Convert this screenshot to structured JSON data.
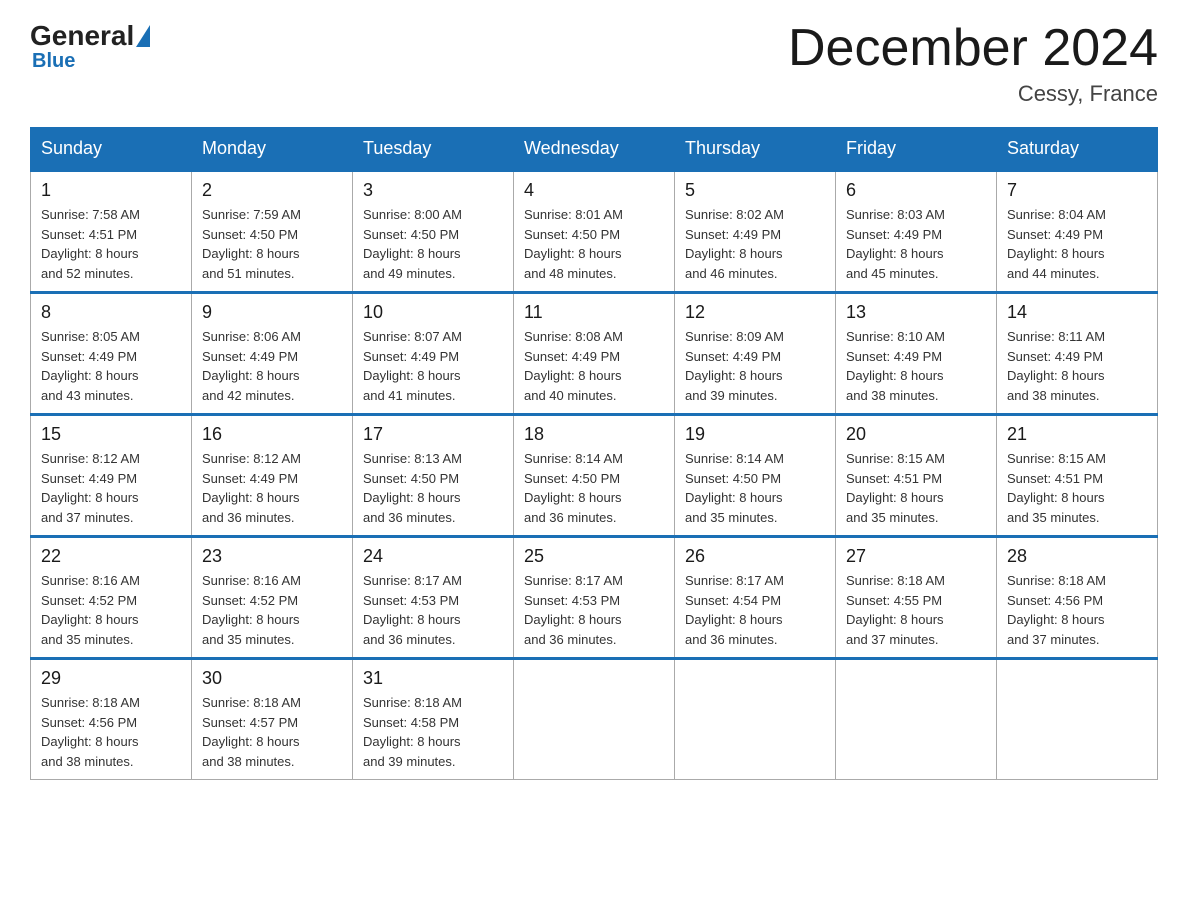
{
  "header": {
    "logo_general": "General",
    "logo_blue": "Blue",
    "month_title": "December 2024",
    "location": "Cessy, France"
  },
  "days_of_week": [
    "Sunday",
    "Monday",
    "Tuesday",
    "Wednesday",
    "Thursday",
    "Friday",
    "Saturday"
  ],
  "weeks": [
    [
      {
        "day": "1",
        "sunrise": "7:58 AM",
        "sunset": "4:51 PM",
        "daylight": "8 hours and 52 minutes."
      },
      {
        "day": "2",
        "sunrise": "7:59 AM",
        "sunset": "4:50 PM",
        "daylight": "8 hours and 51 minutes."
      },
      {
        "day": "3",
        "sunrise": "8:00 AM",
        "sunset": "4:50 PM",
        "daylight": "8 hours and 49 minutes."
      },
      {
        "day": "4",
        "sunrise": "8:01 AM",
        "sunset": "4:50 PM",
        "daylight": "8 hours and 48 minutes."
      },
      {
        "day": "5",
        "sunrise": "8:02 AM",
        "sunset": "4:49 PM",
        "daylight": "8 hours and 46 minutes."
      },
      {
        "day": "6",
        "sunrise": "8:03 AM",
        "sunset": "4:49 PM",
        "daylight": "8 hours and 45 minutes."
      },
      {
        "day": "7",
        "sunrise": "8:04 AM",
        "sunset": "4:49 PM",
        "daylight": "8 hours and 44 minutes."
      }
    ],
    [
      {
        "day": "8",
        "sunrise": "8:05 AM",
        "sunset": "4:49 PM",
        "daylight": "8 hours and 43 minutes."
      },
      {
        "day": "9",
        "sunrise": "8:06 AM",
        "sunset": "4:49 PM",
        "daylight": "8 hours and 42 minutes."
      },
      {
        "day": "10",
        "sunrise": "8:07 AM",
        "sunset": "4:49 PM",
        "daylight": "8 hours and 41 minutes."
      },
      {
        "day": "11",
        "sunrise": "8:08 AM",
        "sunset": "4:49 PM",
        "daylight": "8 hours and 40 minutes."
      },
      {
        "day": "12",
        "sunrise": "8:09 AM",
        "sunset": "4:49 PM",
        "daylight": "8 hours and 39 minutes."
      },
      {
        "day": "13",
        "sunrise": "8:10 AM",
        "sunset": "4:49 PM",
        "daylight": "8 hours and 38 minutes."
      },
      {
        "day": "14",
        "sunrise": "8:11 AM",
        "sunset": "4:49 PM",
        "daylight": "8 hours and 38 minutes."
      }
    ],
    [
      {
        "day": "15",
        "sunrise": "8:12 AM",
        "sunset": "4:49 PM",
        "daylight": "8 hours and 37 minutes."
      },
      {
        "day": "16",
        "sunrise": "8:12 AM",
        "sunset": "4:49 PM",
        "daylight": "8 hours and 36 minutes."
      },
      {
        "day": "17",
        "sunrise": "8:13 AM",
        "sunset": "4:50 PM",
        "daylight": "8 hours and 36 minutes."
      },
      {
        "day": "18",
        "sunrise": "8:14 AM",
        "sunset": "4:50 PM",
        "daylight": "8 hours and 36 minutes."
      },
      {
        "day": "19",
        "sunrise": "8:14 AM",
        "sunset": "4:50 PM",
        "daylight": "8 hours and 35 minutes."
      },
      {
        "day": "20",
        "sunrise": "8:15 AM",
        "sunset": "4:51 PM",
        "daylight": "8 hours and 35 minutes."
      },
      {
        "day": "21",
        "sunrise": "8:15 AM",
        "sunset": "4:51 PM",
        "daylight": "8 hours and 35 minutes."
      }
    ],
    [
      {
        "day": "22",
        "sunrise": "8:16 AM",
        "sunset": "4:52 PM",
        "daylight": "8 hours and 35 minutes."
      },
      {
        "day": "23",
        "sunrise": "8:16 AM",
        "sunset": "4:52 PM",
        "daylight": "8 hours and 35 minutes."
      },
      {
        "day": "24",
        "sunrise": "8:17 AM",
        "sunset": "4:53 PM",
        "daylight": "8 hours and 36 minutes."
      },
      {
        "day": "25",
        "sunrise": "8:17 AM",
        "sunset": "4:53 PM",
        "daylight": "8 hours and 36 minutes."
      },
      {
        "day": "26",
        "sunrise": "8:17 AM",
        "sunset": "4:54 PM",
        "daylight": "8 hours and 36 minutes."
      },
      {
        "day": "27",
        "sunrise": "8:18 AM",
        "sunset": "4:55 PM",
        "daylight": "8 hours and 37 minutes."
      },
      {
        "day": "28",
        "sunrise": "8:18 AM",
        "sunset": "4:56 PM",
        "daylight": "8 hours and 37 minutes."
      }
    ],
    [
      {
        "day": "29",
        "sunrise": "8:18 AM",
        "sunset": "4:56 PM",
        "daylight": "8 hours and 38 minutes."
      },
      {
        "day": "30",
        "sunrise": "8:18 AM",
        "sunset": "4:57 PM",
        "daylight": "8 hours and 38 minutes."
      },
      {
        "day": "31",
        "sunrise": "8:18 AM",
        "sunset": "4:58 PM",
        "daylight": "8 hours and 39 minutes."
      },
      null,
      null,
      null,
      null
    ]
  ],
  "labels": {
    "sunrise": "Sunrise:",
    "sunset": "Sunset:",
    "daylight": "Daylight:"
  }
}
